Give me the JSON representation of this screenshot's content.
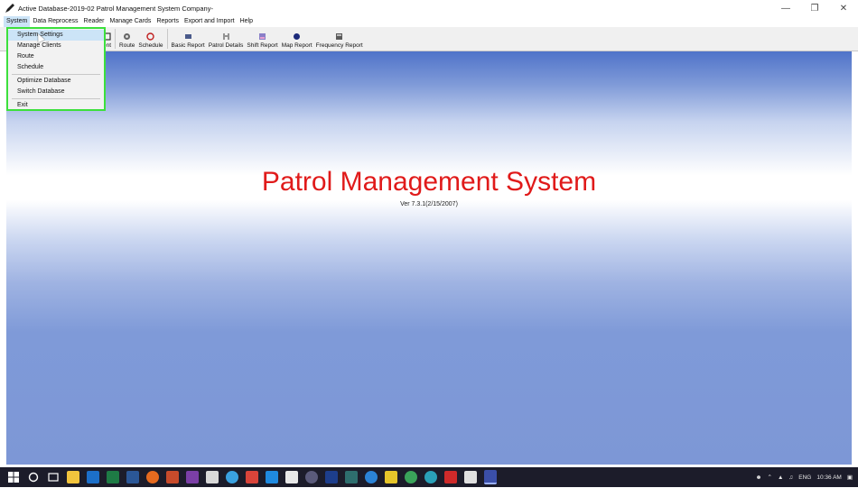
{
  "window": {
    "title": "Active Database-2019-02  Patrol Management System   Company-",
    "minimize_glyph": "—",
    "maximize_glyph": "❐",
    "close_glyph": "✕"
  },
  "menubar": {
    "items": [
      "System",
      "Data Reprocess",
      "Reader",
      "Manage Cards",
      "Reports",
      "Export and Import",
      "Help"
    ]
  },
  "toolbar": {
    "partial_label": "ent",
    "buttons": [
      {
        "label": "Route",
        "icon": "route-icon"
      },
      {
        "label": "Schedule",
        "icon": "schedule-icon"
      },
      {
        "label": "Basic Report",
        "icon": "basic-report-icon"
      },
      {
        "label": "Patrol Details",
        "icon": "patrol-details-icon"
      },
      {
        "label": "Shift Report",
        "icon": "shift-report-icon"
      },
      {
        "label": "Map Report",
        "icon": "map-report-icon"
      },
      {
        "label": "Frequency Report",
        "icon": "frequency-report-icon"
      }
    ]
  },
  "system_menu": {
    "items": [
      {
        "label": "System Settings",
        "hover": true
      },
      {
        "label": "Manage Clients"
      },
      {
        "label": "Route"
      },
      {
        "label": "Schedule"
      },
      {
        "label": "Optimize Database"
      },
      {
        "label": "Switch Database"
      },
      {
        "label": "Exit"
      }
    ],
    "highlight_color": "#3ce03c"
  },
  "main": {
    "title": "Patrol Management System",
    "version": "Ver 7.3.1(2/15/2007)",
    "title_color": "#e01a1a"
  },
  "taskbar": {
    "icons": [
      "windows-start-icon",
      "search-icon",
      "task-view-icon",
      "file-explorer-icon",
      "outlook-icon",
      "excel-icon",
      "word-icon",
      "firefox-icon",
      "powerpoint-icon",
      "onenote-icon",
      "document-icon",
      "chrome-icon",
      "paint-icon",
      "onedrive-icon",
      "app-icon",
      "web-icon",
      "app-icon",
      "app-icon",
      "edge-icon",
      "sticky-notes-icon",
      "chrome-icon",
      "settings-icon",
      "acrobat-icon",
      "photos-icon",
      "patrol-app-icon"
    ],
    "language": "ENG",
    "time": "10:36 AM"
  }
}
